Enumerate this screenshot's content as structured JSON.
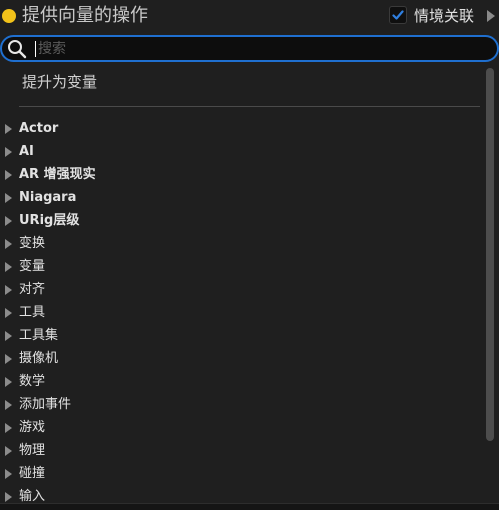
{
  "header": {
    "title": "提供向量的操作",
    "status_color": "#f2c21a",
    "context_label": "情境关联",
    "context_checked": true,
    "context_icon": "chevron-right-icon"
  },
  "search": {
    "placeholder": "搜索",
    "value": "",
    "icon": "search-icon"
  },
  "promote_item": "提升为变量",
  "tree": {
    "items": [
      {
        "label": "Actor",
        "bold": true
      },
      {
        "label": "AI",
        "bold": true
      },
      {
        "label": "AR 增强现实",
        "bold": true
      },
      {
        "label": "Niagara",
        "bold": true
      },
      {
        "label": "URig层级",
        "bold": true
      },
      {
        "label": "变换",
        "bold": false
      },
      {
        "label": "变量",
        "bold": false
      },
      {
        "label": "对齐",
        "bold": false
      },
      {
        "label": "工具",
        "bold": false
      },
      {
        "label": "工具集",
        "bold": false
      },
      {
        "label": "摄像机",
        "bold": false
      },
      {
        "label": "数学",
        "bold": false
      },
      {
        "label": "添加事件",
        "bold": false
      },
      {
        "label": "游戏",
        "bold": false
      },
      {
        "label": "物理",
        "bold": false
      },
      {
        "label": "碰撞",
        "bold": false
      },
      {
        "label": "输入",
        "bold": false
      }
    ]
  },
  "colors": {
    "accent": "#1f6fcf",
    "background": "#1f1f1f",
    "checkbox_check": "#2f7fe0"
  }
}
